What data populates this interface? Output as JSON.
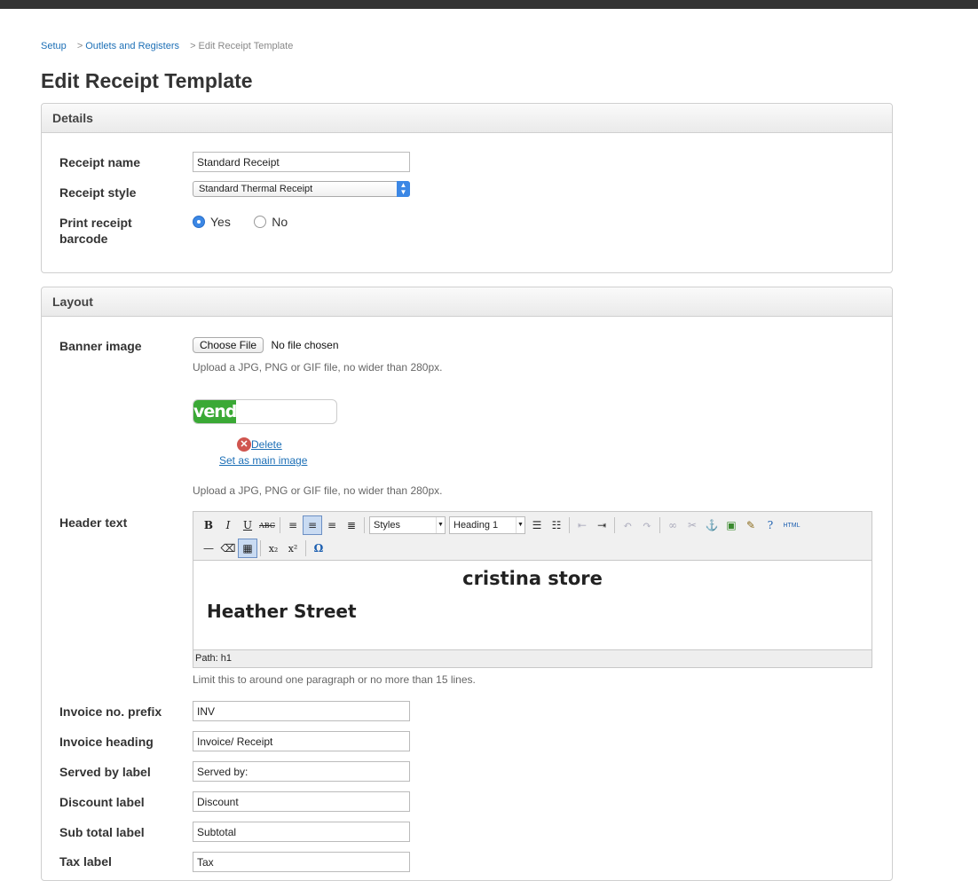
{
  "breadcrumb": {
    "items": [
      "Setup",
      "Outlets and Registers"
    ],
    "current": "Edit Receipt Template",
    "separator": ">"
  },
  "page_title": "Edit Receipt Template",
  "details": {
    "header": "Details",
    "receipt_name_label": "Receipt name",
    "receipt_name_value": "Standard Receipt",
    "receipt_style_label": "Receipt style",
    "receipt_style_value": "Standard Thermal Receipt",
    "print_barcode_label_line1": "Print receipt",
    "print_barcode_label_line2": "barcode",
    "yes_label": "Yes",
    "no_label": "No",
    "selected": "Yes"
  },
  "layout": {
    "header": "Layout",
    "banner_label": "Banner image",
    "choose_file": "Choose File",
    "no_file": "No file chosen",
    "upload_hint": "Upload a JPG, PNG or GIF file, no wider than 280px.",
    "logo_text": "vend",
    "delete_label": "Delete",
    "set_main_label": "Set as main image",
    "upload_hint_2": "Upload a JPG, PNG or GIF file, no wider than 280px.",
    "header_text_label": "Header text",
    "editor": {
      "styles_dropdown": "Styles",
      "format_dropdown": "Heading 1",
      "html_button": "HTML",
      "content_line1": "cristina store",
      "content_line2": "Heather Street",
      "path": "Path: h1"
    },
    "header_hint": "Limit this to around one paragraph or no more than 15 lines.",
    "fields": [
      {
        "label": "Invoice no. prefix",
        "value": "INV"
      },
      {
        "label": "Invoice heading",
        "value": "Invoice/ Receipt"
      },
      {
        "label": "Served by label",
        "value": "Served by:"
      },
      {
        "label": "Discount label",
        "value": "Discount"
      },
      {
        "label": "Sub total label",
        "value": "Subtotal"
      },
      {
        "label": "Tax label",
        "value": "Tax"
      }
    ]
  },
  "colors": {
    "link": "#1c6fb6",
    "accent": "#3b87e5",
    "logo_green": "#3aa935",
    "topbar": "#333333"
  }
}
